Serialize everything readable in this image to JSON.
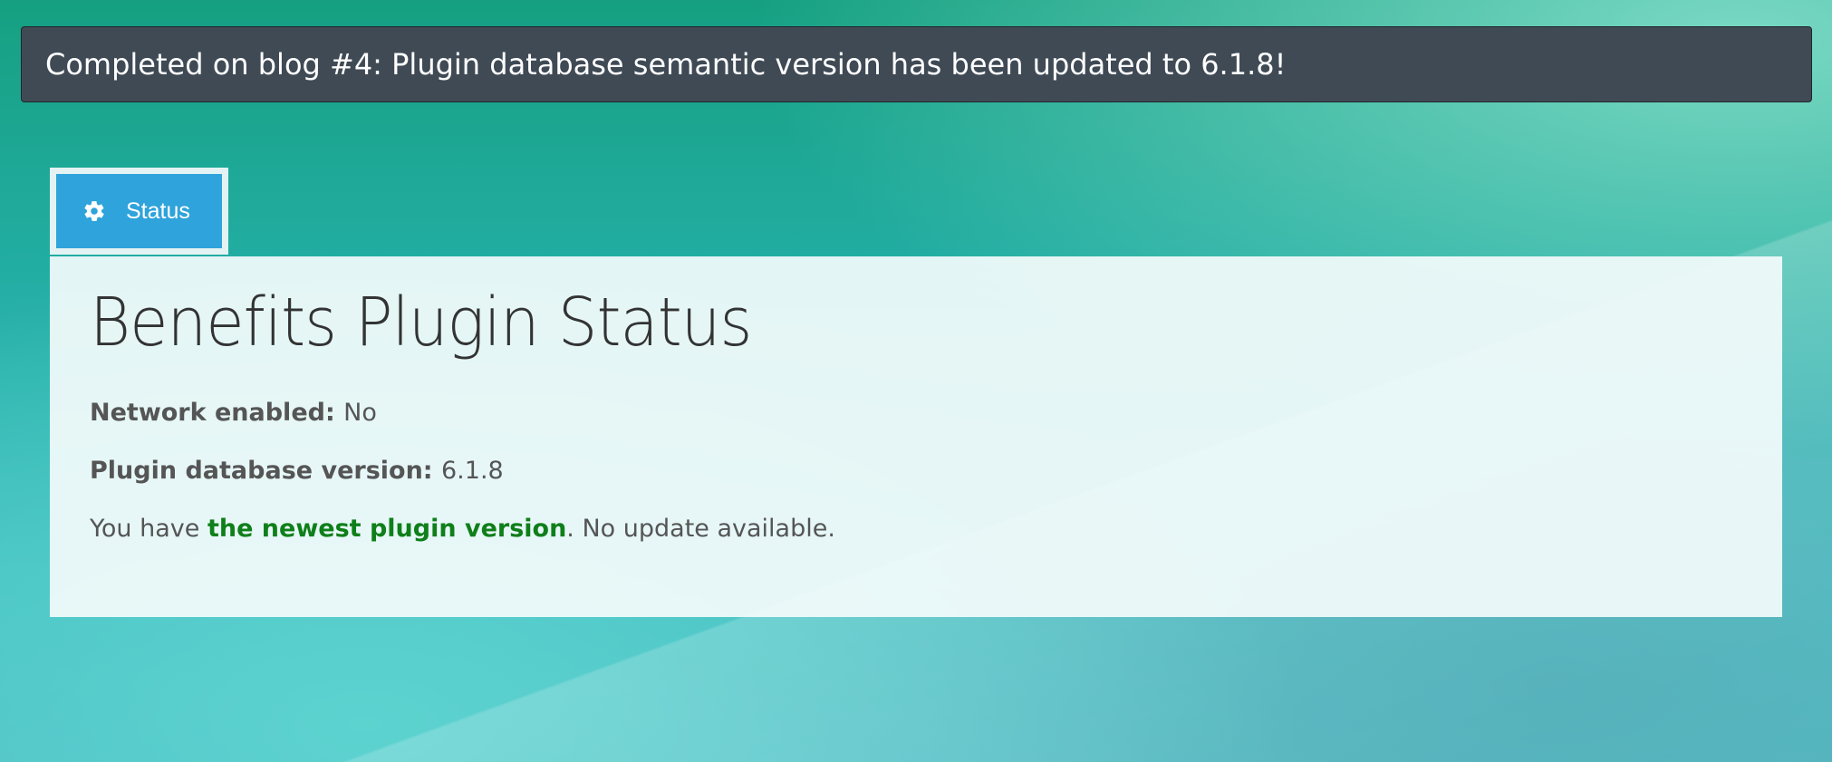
{
  "notice": {
    "text": "Completed on blog #4: Plugin database semantic version has been updated to 6.1.8!"
  },
  "tabs": [
    {
      "label": "Status",
      "icon": "gear-icon",
      "active": true
    }
  ],
  "panel": {
    "title": "Benefits Plugin Status",
    "network_enabled": {
      "label": "Network enabled:",
      "value": "No"
    },
    "db_version": {
      "label": "Plugin database version:",
      "value": "6.1.8"
    },
    "update_message": {
      "prefix": "You have ",
      "highlight": "the newest plugin version",
      "suffix": ". No update available."
    }
  },
  "colors": {
    "notice_bg": "#3f4a55",
    "tab_bg": "#2fa3db",
    "highlight_green": "#0f7f1a"
  }
}
